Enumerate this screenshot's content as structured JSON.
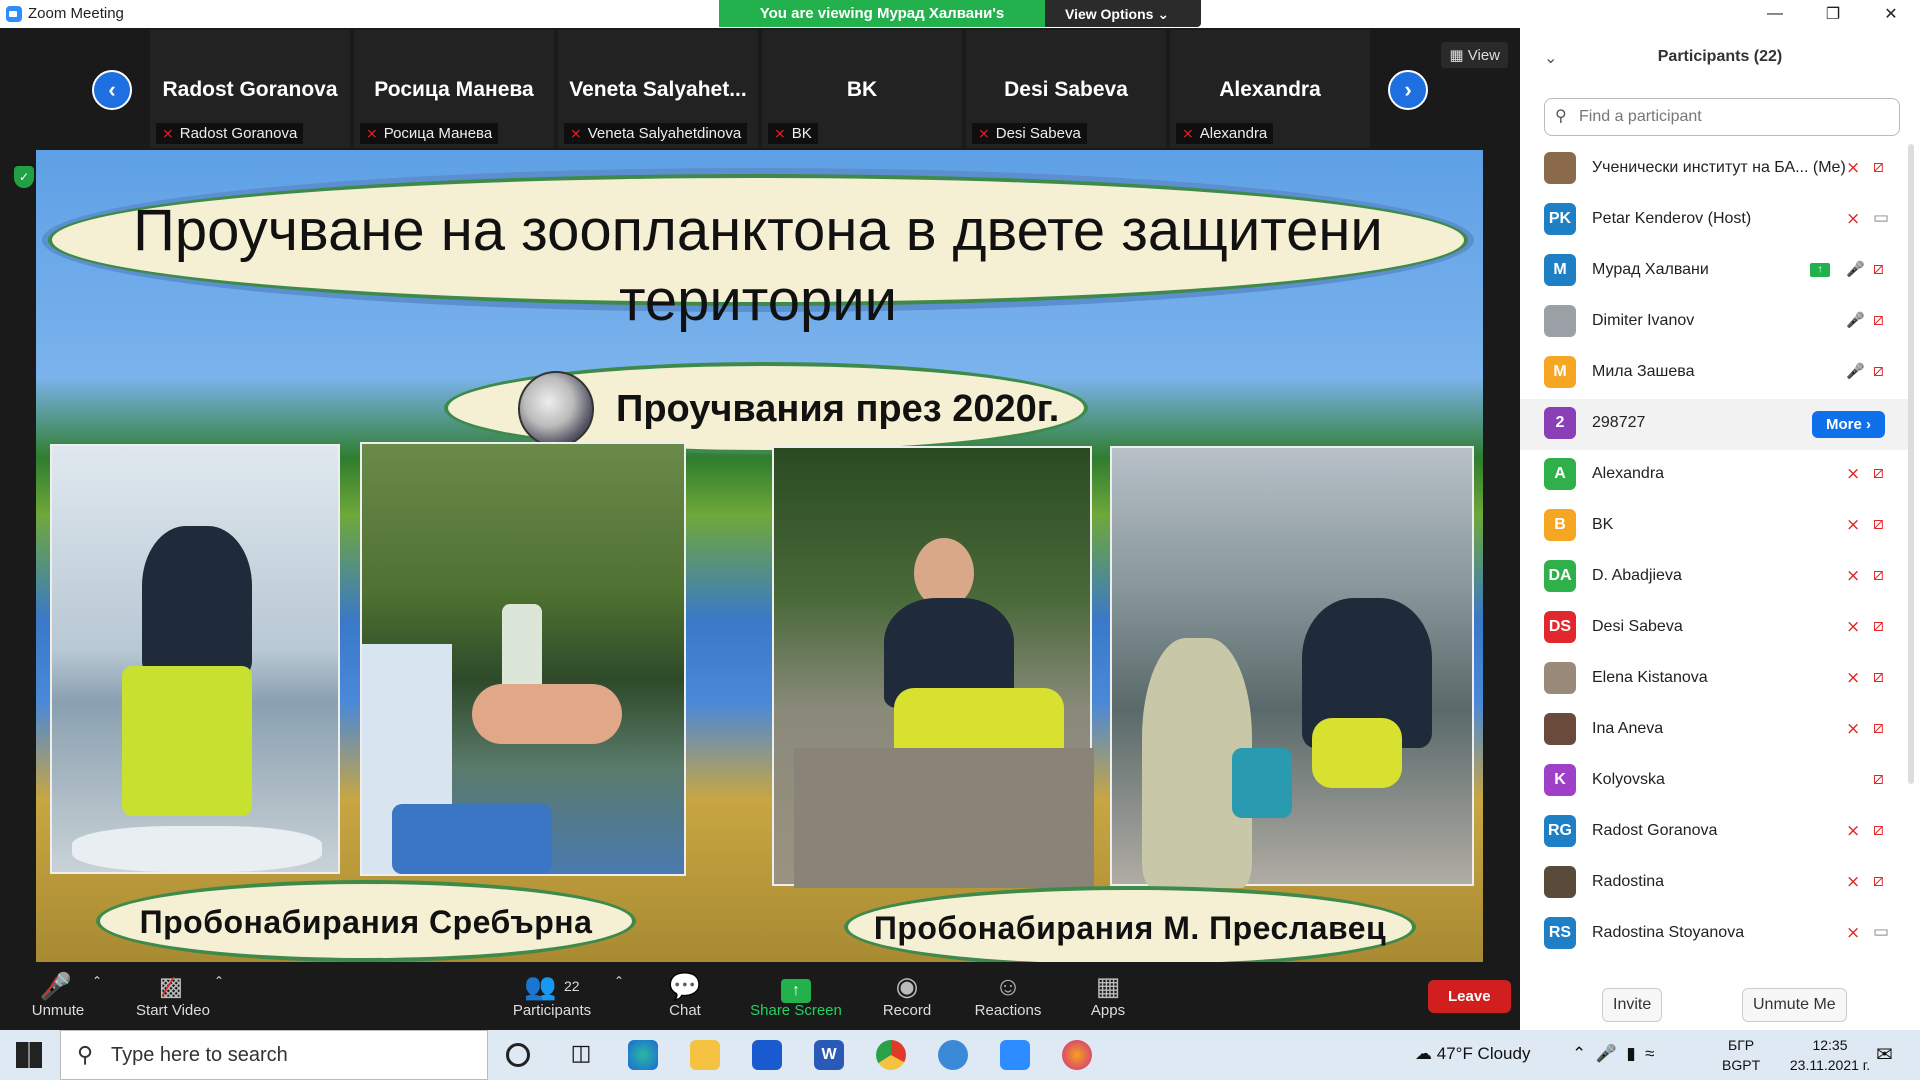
{
  "window": {
    "title": "Zoom Meeting"
  },
  "banner": {
    "viewing": "You are viewing Мурад Халвани's screen",
    "view_options": "View Options"
  },
  "strip": {
    "view_label": "View",
    "tiles": [
      {
        "name": "Radost Goranova",
        "label": "Radost Goranova"
      },
      {
        "name": "Росица Манева",
        "label": "Росица Манева"
      },
      {
        "name": "Veneta  Salyahet...",
        "label": "Veneta Salyahetdinova"
      },
      {
        "name": "BK",
        "label": "BK"
      },
      {
        "name": "Desi Sabeva",
        "label": "Desi Sabeva"
      },
      {
        "name": "Alexandra",
        "label": "Alexandra"
      }
    ]
  },
  "slide": {
    "title_line1": "Проучване на зоопланктона в двете защитени",
    "title_line2": "територии",
    "subtitle": "Проучвания през 2020г.",
    "caption_left": "Пробонабирания Сребърна",
    "caption_right": "Пробонабирания М. Преславец"
  },
  "participants": {
    "header": "Participants (22)",
    "search_placeholder": "Find a participant",
    "more_label": "More",
    "list": [
      {
        "name": "Ученически институт на БА... (Me)",
        "initials": "",
        "color": "#8a6a4a",
        "mic": "muted",
        "cam": "off"
      },
      {
        "name": "Petar Kenderov (Host)",
        "initials": "PK",
        "color": "#1e7fc4",
        "mic": "muted",
        "cam": "on"
      },
      {
        "name": "Мурад Халвани",
        "initials": "M",
        "color": "#1e7fc4",
        "mic": "on",
        "cam": "off",
        "sharing": true
      },
      {
        "name": "Dimiter Ivanov",
        "initials": "",
        "color": "#9aa0a6",
        "mic": "on",
        "cam": "off"
      },
      {
        "name": "Мила Зашева",
        "initials": "M",
        "color": "#f5a623",
        "mic": "on",
        "cam": "off"
      },
      {
        "name": "298727",
        "initials": "2",
        "color": "#8a3fb8",
        "mic": "",
        "cam": "",
        "more": true
      },
      {
        "name": "Alexandra",
        "initials": "A",
        "color": "#2fb04a",
        "mic": "muted",
        "cam": "off"
      },
      {
        "name": "BK",
        "initials": "B",
        "color": "#f5a623",
        "mic": "muted",
        "cam": "off"
      },
      {
        "name": "D. Abadjieva",
        "initials": "DA",
        "color": "#2fb04a",
        "mic": "muted",
        "cam": "off"
      },
      {
        "name": "Desi Sabeva",
        "initials": "DS",
        "color": "#e0282e",
        "mic": "muted",
        "cam": "off"
      },
      {
        "name": "Elena Kistanova",
        "initials": "",
        "color": "#9a8a7a",
        "mic": "muted",
        "cam": "off"
      },
      {
        "name": "Ina Aneva",
        "initials": "",
        "color": "#6a4a3a",
        "mic": "muted",
        "cam": "off"
      },
      {
        "name": "Kolyovska",
        "initials": "K",
        "color": "#a03fc8",
        "mic": "",
        "cam": "off"
      },
      {
        "name": "Radost Goranova",
        "initials": "RG",
        "color": "#1e7fc4",
        "mic": "muted",
        "cam": "off"
      },
      {
        "name": "Radostina",
        "initials": "",
        "color": "#5a4a3a",
        "mic": "muted",
        "cam": "off"
      },
      {
        "name": "Radostina Stoyanova",
        "initials": "RS",
        "color": "#1e7fc4",
        "mic": "muted",
        "cam": "on"
      }
    ],
    "invite_label": "Invite",
    "unmute_me_label": "Unmute Me"
  },
  "toolbar": {
    "unmute": "Unmute",
    "start_video": "Start Video",
    "participants": "Participants",
    "participants_count": "22",
    "chat": "Chat",
    "share_screen": "Share Screen",
    "record": "Record",
    "reactions": "Reactions",
    "apps": "Apps",
    "leave": "Leave"
  },
  "taskbar": {
    "search_placeholder": "Type here to search",
    "weather": "47°F  Cloudy",
    "lang_top": "БГР",
    "lang_bottom": "BGPT",
    "time": "12:35",
    "date": "23.11.2021 г."
  }
}
